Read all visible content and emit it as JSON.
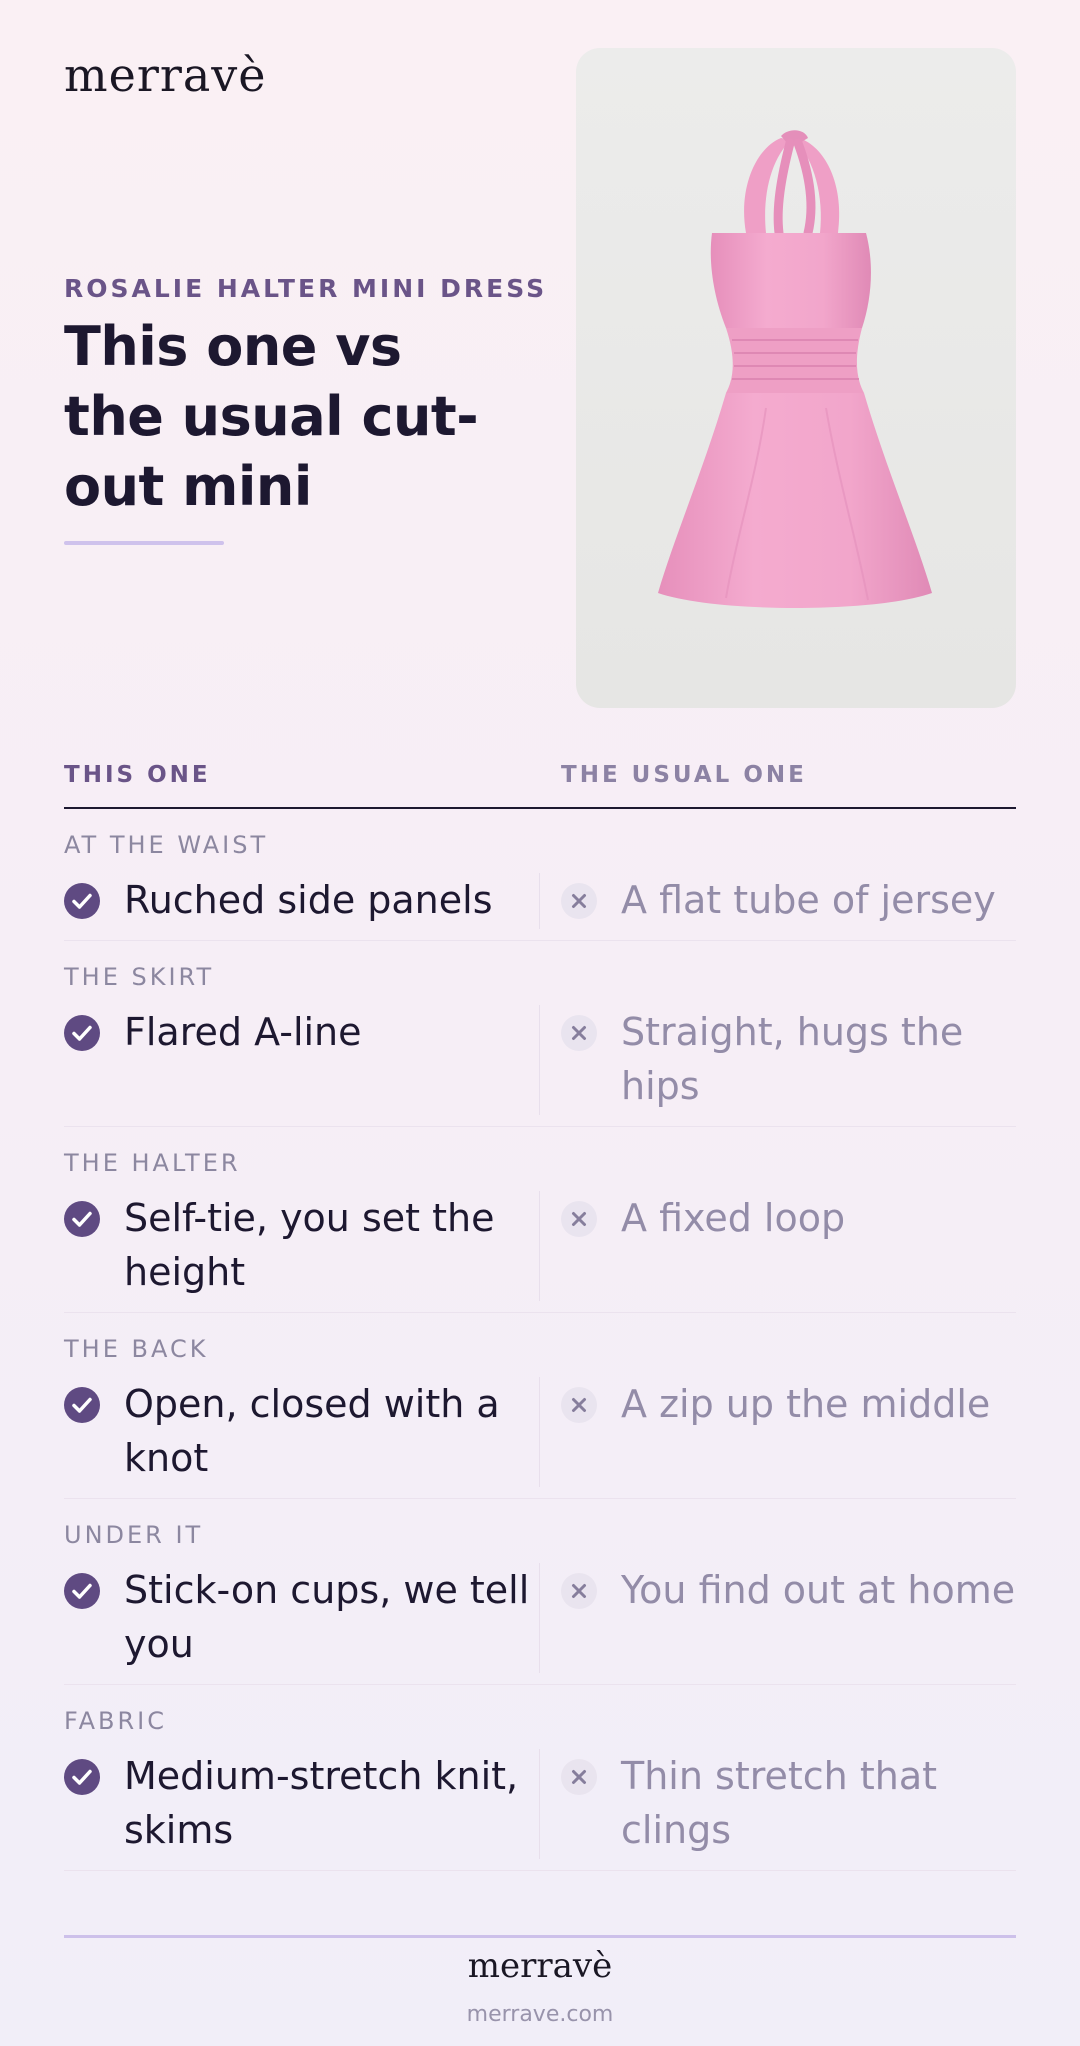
{
  "brand": {
    "logo": "merravè",
    "url": "merrave.com"
  },
  "product": {
    "name": "ROSALIE HALTER MINI DRESS",
    "headline": "This one vs the usual cut-out mini",
    "color": "#f2a9cc"
  },
  "table": {
    "col_this": "THIS ONE",
    "col_usual": "THE USUAL ONE",
    "rows": [
      {
        "label": "AT THE WAIST",
        "this": "Ruched side panels",
        "usual": "A flat tube of jersey"
      },
      {
        "label": "THE SKIRT",
        "this": "Flared A-line",
        "usual": "Straight, hugs the hips"
      },
      {
        "label": "THE HALTER",
        "this": "Self-tie, you set the height",
        "usual": "A fixed loop"
      },
      {
        "label": "THE BACK",
        "this": "Open, closed with a knot",
        "usual": "A zip up the middle"
      },
      {
        "label": "UNDER IT",
        "this": "Stick-on cups, we tell you",
        "usual": "You find out at home"
      },
      {
        "label": "FABRIC",
        "this": "Medium-stretch knit, skims",
        "usual": "Thin stretch that clings"
      }
    ]
  },
  "icons": {
    "this": "check-circle-icon",
    "usual": "x-circle-icon"
  },
  "colors": {
    "accent": "#5f4a82",
    "eyebrow": "#6a5488",
    "muted": "#938ca8"
  }
}
